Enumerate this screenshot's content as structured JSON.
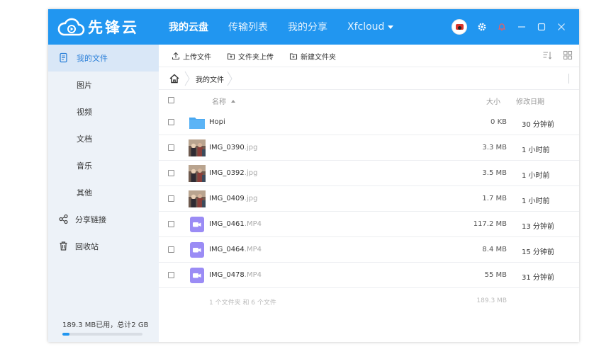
{
  "app": {
    "brand_name": "先锋云",
    "colors": {
      "primary": "#2196f0",
      "sidebar_bg": "#edf2f8",
      "active_item_bg": "#d9e7f7",
      "active_text": "#2a7fd8",
      "folder": "#5bb4f6",
      "video_icon": "#9b8cf5"
    }
  },
  "nav": {
    "items": [
      {
        "label": "我的云盘",
        "active": true
      },
      {
        "label": "传输列表",
        "active": false
      },
      {
        "label": "我的分享",
        "active": false
      },
      {
        "label": "Xfcloud",
        "active": false
      }
    ]
  },
  "titlebar_icons": [
    "avatar",
    "gear-icon",
    "bell-icon",
    "minimize-icon",
    "maximize-icon",
    "close-icon"
  ],
  "sidebar": {
    "items": [
      {
        "label": "我的文件",
        "icon": "file-icon",
        "active": true
      },
      {
        "label": "图片"
      },
      {
        "label": "视频"
      },
      {
        "label": "文档"
      },
      {
        "label": "音乐"
      },
      {
        "label": "其他"
      },
      {
        "label": "分享链接",
        "icon": "share-icon"
      },
      {
        "label": "回收站",
        "icon": "trash-icon"
      }
    ],
    "storage_text": "189.3 MB已用，总计2 GB",
    "storage_used_fraction": 0.09
  },
  "toolbar": {
    "upload_file": "上传文件",
    "upload_folder": "文件夹上传",
    "new_folder": "新建文件夹"
  },
  "breadcrumb": {
    "current": "我的文件"
  },
  "table": {
    "col_name": "名称",
    "col_size": "大小",
    "col_date": "修改日期",
    "rows": [
      {
        "name": "Hopi",
        "ext": "",
        "type": "folder",
        "size": "0 KB",
        "date": "30 分钟前"
      },
      {
        "name": "IMG_0390",
        "ext": ".jpg",
        "type": "image",
        "size": "3.3 MB",
        "date": "1 小时前"
      },
      {
        "name": "IMG_0392",
        "ext": ".jpg",
        "type": "image",
        "size": "3.5 MB",
        "date": "1 小时前"
      },
      {
        "name": "IMG_0409",
        "ext": ".jpg",
        "type": "image",
        "size": "1.7 MB",
        "date": "1 小时前"
      },
      {
        "name": "IMG_0461",
        "ext": ".MP4",
        "type": "video",
        "size": "117.2 MB",
        "date": "13 分钟前"
      },
      {
        "name": "IMG_0464",
        "ext": ".MP4",
        "type": "video",
        "size": "8.4 MB",
        "date": "15 分钟前"
      },
      {
        "name": "IMG_0478",
        "ext": ".MP4",
        "type": "video",
        "size": "55 MB",
        "date": "31 分钟前"
      }
    ],
    "summary_text": "1 个文件夹 和 6 个文件",
    "summary_size": "189.3 MB"
  }
}
